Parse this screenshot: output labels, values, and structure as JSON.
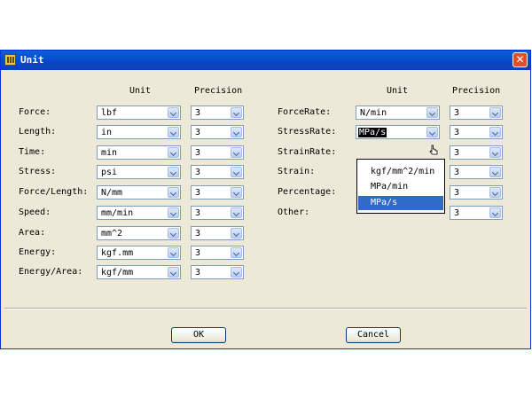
{
  "window": {
    "title": "Unit",
    "icon": "unit-app-icon",
    "close_icon": "close-icon"
  },
  "headers": {
    "unit": "Unit",
    "precision": "Precision"
  },
  "left_rows": [
    {
      "label": "Force:",
      "unit": "lbf",
      "precision": "3"
    },
    {
      "label": "Length:",
      "unit": "in",
      "precision": "3"
    },
    {
      "label": "Time:",
      "unit": "min",
      "precision": "3"
    },
    {
      "label": "Stress:",
      "unit": "psi",
      "precision": "3"
    },
    {
      "label": "Force/Length:",
      "unit": "N/mm",
      "precision": "3"
    },
    {
      "label": "Speed:",
      "unit": "mm/min",
      "precision": "3"
    },
    {
      "label": "Area:",
      "unit": "mm^2",
      "precision": "3"
    },
    {
      "label": "Energy:",
      "unit": "kgf.mm",
      "precision": "3"
    },
    {
      "label": "Energy/Area:",
      "unit": "kgf/mm",
      "precision": "3"
    }
  ],
  "right_rows": [
    {
      "label": "ForceRate:",
      "unit": "N/min",
      "precision": "3"
    },
    {
      "label": "StressRate:",
      "unit": "MPa/s",
      "precision": "3"
    },
    {
      "label": "StrainRate:",
      "precision": "3"
    },
    {
      "label": "Strain:",
      "precision": "3"
    },
    {
      "label": "Percentage:",
      "precision": "3"
    },
    {
      "label": "Other:",
      "precision": "3"
    }
  ],
  "dropdown": {
    "options": [
      "kgf/mm^2/min",
      "MPa/min",
      "MPa/s"
    ],
    "highlighted": "MPa/s"
  },
  "buttons": {
    "ok": "OK",
    "cancel": "Cancel"
  },
  "colors": {
    "title_bar": "#0a5fdc",
    "dialog_bg": "#ece9d8",
    "highlight": "#316ac5",
    "close": "#e0502f"
  }
}
